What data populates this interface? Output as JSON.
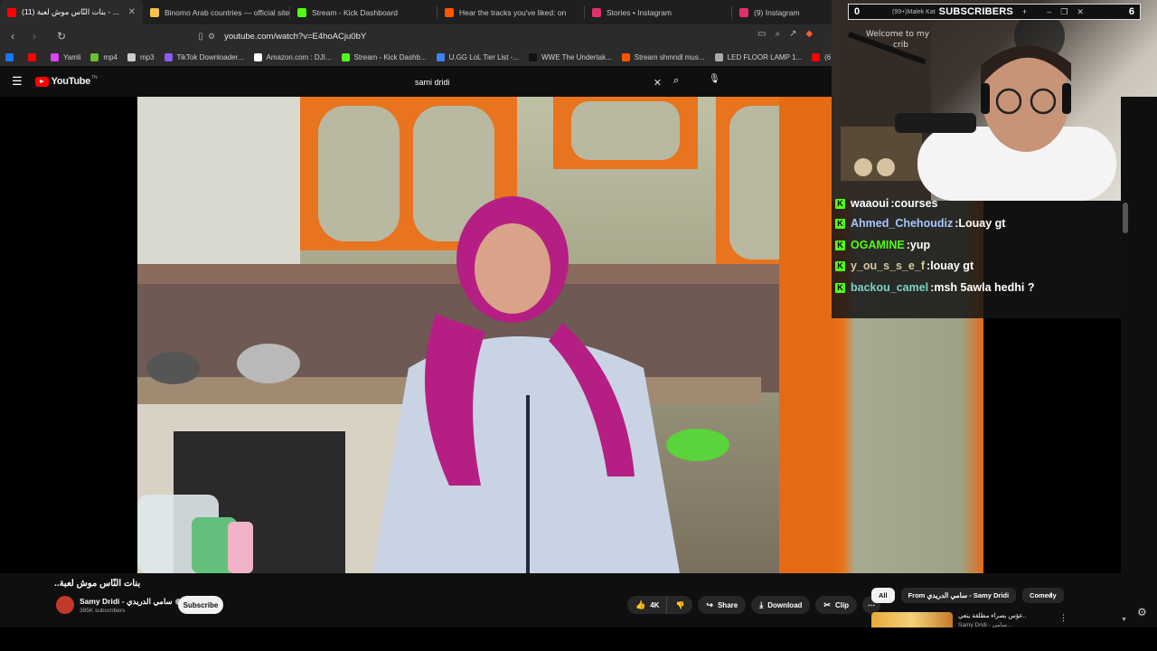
{
  "browser": {
    "tabs": [
      {
        "label": "(11) بنات النّاس موش لعبة - ...",
        "color": "#ff0000",
        "active": true
      },
      {
        "label": "Binomo Arab countries — official site",
        "color": "#f6c343"
      },
      {
        "label": "Stream - Kick Dashboard",
        "color": "#53fc18"
      },
      {
        "label": "Hear the tracks you've liked: on",
        "color": "#ff5500"
      },
      {
        "label": "Stories • Instagram",
        "color": "#e1306c"
      },
      {
        "label": "(9) Instagram",
        "color": "#e1306c"
      }
    ],
    "url": "youtube.com/watch?v=E4hoACju0bY",
    "bookmarks": [
      {
        "label": "",
        "color": "#1877f2"
      },
      {
        "label": "",
        "color": "#ff0000"
      },
      {
        "label": "Yamli",
        "color": "#d946ef"
      },
      {
        "label": "mp4",
        "color": "#6abf2e"
      },
      {
        "label": "mp3",
        "color": "#cccccc"
      },
      {
        "label": "TikTok Downloader...",
        "color": "#8b5cf6"
      },
      {
        "label": "Amazon.com : DJI...",
        "color": "#ffffff"
      },
      {
        "label": "Stream - Kick Dashb...",
        "color": "#53fc18"
      },
      {
        "label": "U.GG LoL Tier List -...",
        "color": "#3b82f6"
      },
      {
        "label": "WWE The Undertak...",
        "color": "#111111"
      },
      {
        "label": "Stream shmndl mus...",
        "color": "#ff5500"
      },
      {
        "label": "LED FLOOR LAMP 1...",
        "color": "#aaaaaa"
      },
      {
        "label": "(6",
        "color": "#ff0000"
      }
    ]
  },
  "youtube": {
    "logo_text": "YouTube",
    "logo_tm": "TN",
    "search_value": "sami dridi",
    "video_title": "..بنات النّاس موش لعبة",
    "channel_name": "Samy Dridi - سامي الدريدي",
    "subscribers": "395K subscribers",
    "subscribe_label": "Subscribe",
    "like_count": "4K",
    "share_label": "Share",
    "download_label": "Download",
    "clip_label": "Clip",
    "chips": [
      {
        "label": "All",
        "active": true
      },
      {
        "label": "From سامي الدريدي - Samy Dridi",
        "active": false
      },
      {
        "label": "Comedy",
        "active": false
      }
    ],
    "rec_title": "عؤس بصراء مطلقة يتعي..",
    "rec_channel": "Samy Dridi - سامي..."
  },
  "overlay": {
    "subs_left": "0",
    "subs_mid": "(99+)Malek Kat",
    "subs_label": "SUBSCRIBERS",
    "subs_right": "6",
    "chat": [
      {
        "user": "waaoui",
        "message": "courses",
        "color": "#ffffff"
      },
      {
        "user": "Ahmed_Chehoudiz",
        "message": "Louay gt",
        "color": "#a7c7ff"
      },
      {
        "user": "OGAMINE",
        "message": "yup",
        "color": "#53fc18"
      },
      {
        "user": "y_ou_s_s_e_f",
        "message": "louay gt",
        "color": "#d8c7a0"
      },
      {
        "user": "backou_camel",
        "message": "msh 5awla hedhi ?",
        "color": "#7cd3c8"
      }
    ]
  }
}
